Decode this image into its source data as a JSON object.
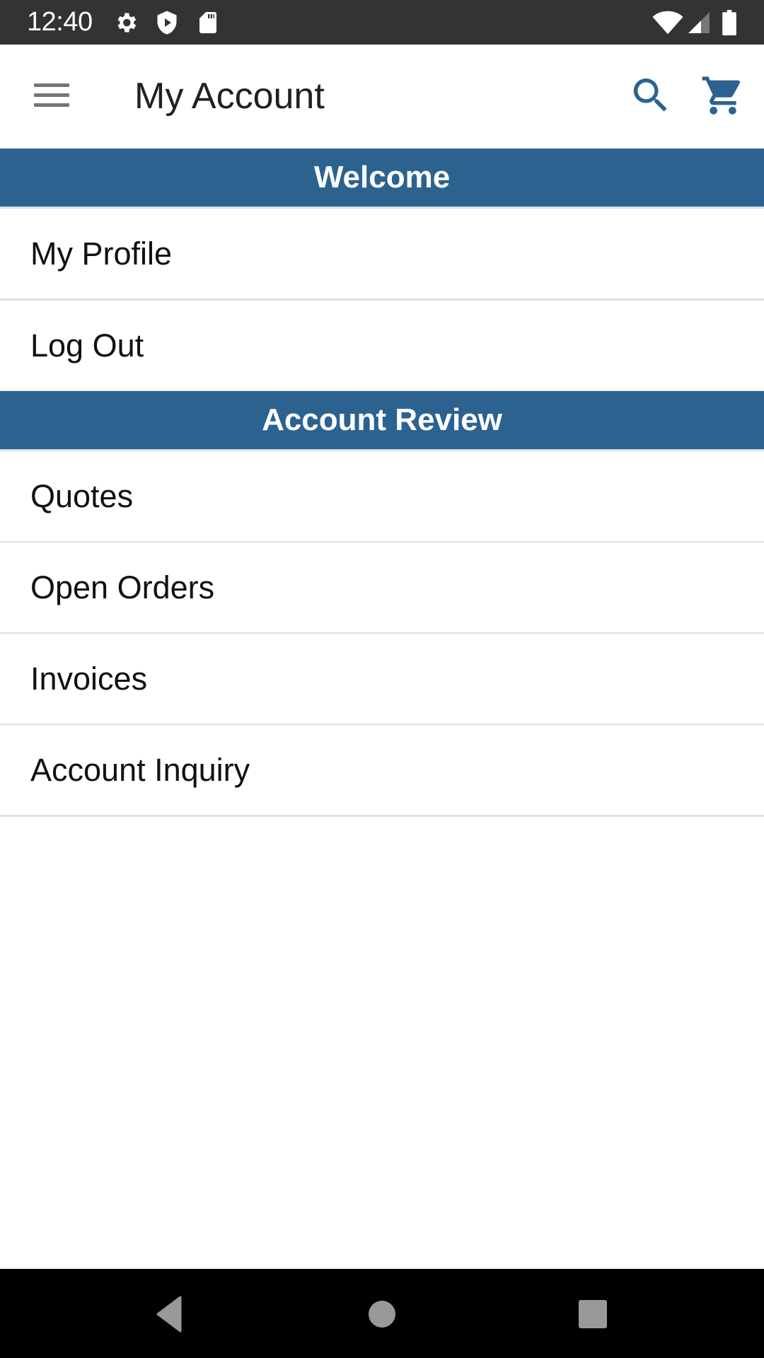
{
  "status_bar": {
    "time": "12:40",
    "left_icons": [
      "settings-icon",
      "shield-play-icon",
      "sd-card-icon"
    ],
    "right_icons": [
      "wifi-icon",
      "cell-signal-icon",
      "battery-icon"
    ]
  },
  "app_bar": {
    "title": "My Account",
    "menu_icon": "hamburger-menu-icon",
    "search_icon": "search-icon",
    "cart_icon": "shopping-cart-icon"
  },
  "colors": {
    "accent": "#2C6290",
    "status_bar": "#333333",
    "divider": "#e0e0e0"
  },
  "sections": [
    {
      "header": "Welcome",
      "items": [
        {
          "label": "My Profile"
        },
        {
          "label": "Log Out"
        }
      ]
    },
    {
      "header": "Account Review",
      "items": [
        {
          "label": "Quotes"
        },
        {
          "label": "Open Orders"
        },
        {
          "label": "Invoices"
        },
        {
          "label": "Account Inquiry"
        }
      ]
    }
  ],
  "nav_bar": {
    "buttons": [
      "back-icon",
      "home-icon",
      "recents-icon"
    ]
  }
}
